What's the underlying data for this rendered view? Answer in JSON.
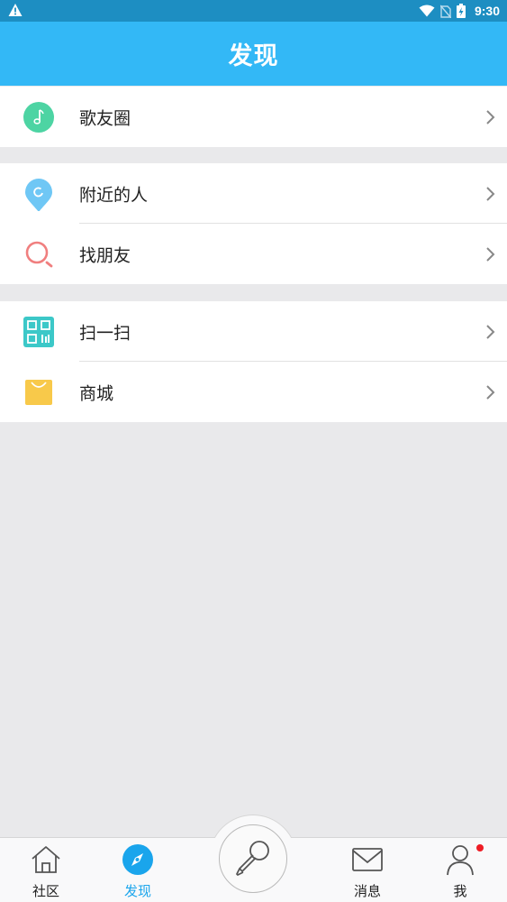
{
  "status_bar": {
    "time": "9:30",
    "icons": [
      "warning-icon",
      "wifi-icon",
      "no-sim-icon",
      "battery-charging-icon"
    ]
  },
  "header": {
    "title": "发现"
  },
  "sections": [
    {
      "items": [
        {
          "label": "歌友圈",
          "icon": "music-note-icon",
          "color": "#4dd4a3"
        }
      ]
    },
    {
      "items": [
        {
          "label": "附近的人",
          "icon": "location-pin-icon",
          "color": "#6fc7f5"
        },
        {
          "label": "找朋友",
          "icon": "search-icon",
          "color": "#f07f7f"
        }
      ]
    },
    {
      "items": [
        {
          "label": "扫一扫",
          "icon": "qr-code-icon",
          "color": "#3cc8c8"
        },
        {
          "label": "商城",
          "icon": "shopping-bag-icon",
          "color": "#f8c94a"
        }
      ]
    }
  ],
  "tabbar": {
    "tabs": [
      {
        "label": "社区",
        "icon": "home-icon"
      },
      {
        "label": "发现",
        "icon": "compass-icon",
        "active": true
      },
      {
        "label": "消息",
        "icon": "mail-icon"
      },
      {
        "label": "我",
        "icon": "person-icon",
        "badge": "red-dot"
      }
    ],
    "center_button": {
      "icon": "microphone-icon"
    }
  },
  "colors": {
    "status_bar": "#1d8ec2",
    "header": "#33b8f6",
    "active_tab": "#1aa5ec",
    "background": "#e9e9eb"
  }
}
